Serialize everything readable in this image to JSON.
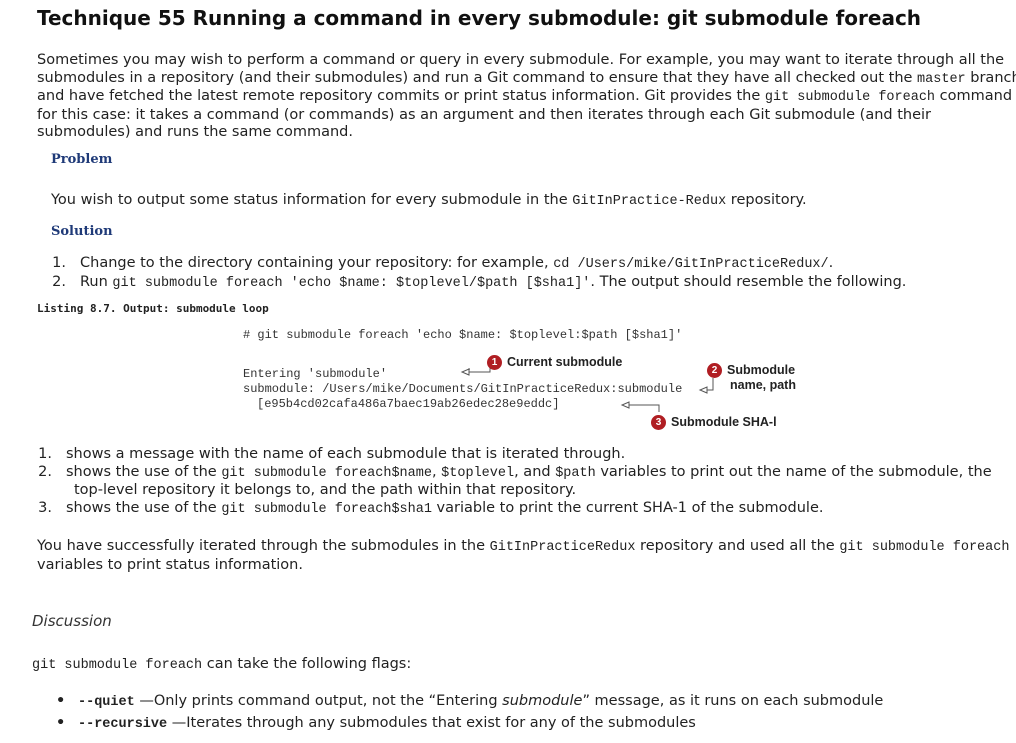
{
  "title": "Technique 55 Running a command in every submodule: git submodule foreach",
  "intro": {
    "l1": "Sometimes you may wish to perform a command or query in every submodule. For example, you may want to iterate through all the",
    "l2a": "submodules in a repository (and their submodules) and run a Git command to ensure that they have all checked out the ",
    "l2code": "master",
    "l2b": " branch",
    "l3a": "and have fetched the latest remote repository commits or print status information. Git provides the ",
    "l3code": "git submodule foreach",
    "l3b": " command",
    "l4": "for this case: it takes a command (or commands) as an argument and then iterates through each Git submodule (and their",
    "l5": "submodules) and runs the same command."
  },
  "problem": {
    "heading": "Problem",
    "text_a": "You wish to output some status information for every submodule in the ",
    "text_code": "GitInPractice-Redux",
    "text_b": " repository."
  },
  "solution": {
    "heading": "Solution",
    "steps": [
      {
        "num": "1.",
        "a": "Change to the directory containing your repository: for example, ",
        "code": "cd /Users/mike/GitInPracticeRedux/",
        "b": "."
      },
      {
        "num": "2.",
        "a": "Run ",
        "code": "git submodule foreach 'echo $name: $toplevel/$path [$sha1]'",
        "b": ". The output should resemble the following."
      }
    ]
  },
  "listing": {
    "caption": "Listing 8.7. Output: submodule loop",
    "cmd": "# git submodule foreach 'echo $name: $toplevel:$path [$sha1]'",
    "out1": "Entering 'submodule'",
    "out2": "submodule: /Users/mike/Documents/GitInPracticeRedux:submodule",
    "out3": "[e95b4cd02cafa486a7baec19ab26edec28e9eddc]",
    "callouts": [
      {
        "num": "1",
        "label": "Current submodule"
      },
      {
        "num": "2",
        "label1": "Submodule",
        "label2": "name, path"
      },
      {
        "num": "3",
        "label": "Submodule SHA-l"
      }
    ]
  },
  "explanations": [
    {
      "num": "1.",
      "a": "shows a message with the name of each submodule that is iterated through."
    },
    {
      "num": "2.",
      "a": "shows the use of the ",
      "code1": "git submodule foreach$name",
      "b": ", ",
      "code2": "$toplevel",
      "c": ", and ",
      "code3": "$path",
      "d": " variables to print out the name of the submodule, the",
      "cont": "top-level repository it belongs to, and the path within that repository."
    },
    {
      "num": "3.",
      "a": "shows the use of the ",
      "code1": "git submodule foreach$sha1",
      "b": " variable to print the current SHA-1 of the submodule."
    }
  ],
  "summary": {
    "l1a": "You have successfully iterated through the submodules in the ",
    "l1code": "GitInPracticeRedux",
    "l1b": " repository and used all the ",
    "l1code2": "git submodule foreach",
    "l2": "variables to print status information."
  },
  "discussion": {
    "heading": "Discussion",
    "flags_code": "git submodule foreach",
    "flags_text": " can take the following flags:",
    "bullets": [
      {
        "flag": "--quiet",
        "a": " —Only prints command output, not the “Entering ",
        "em": "submodule",
        "b": "” message, as it runs on each submodule"
      },
      {
        "flag": "--recursive",
        "a": " —Iterates through any submodules that exist for any of the submodules",
        "em": "",
        "b": ""
      }
    ]
  }
}
